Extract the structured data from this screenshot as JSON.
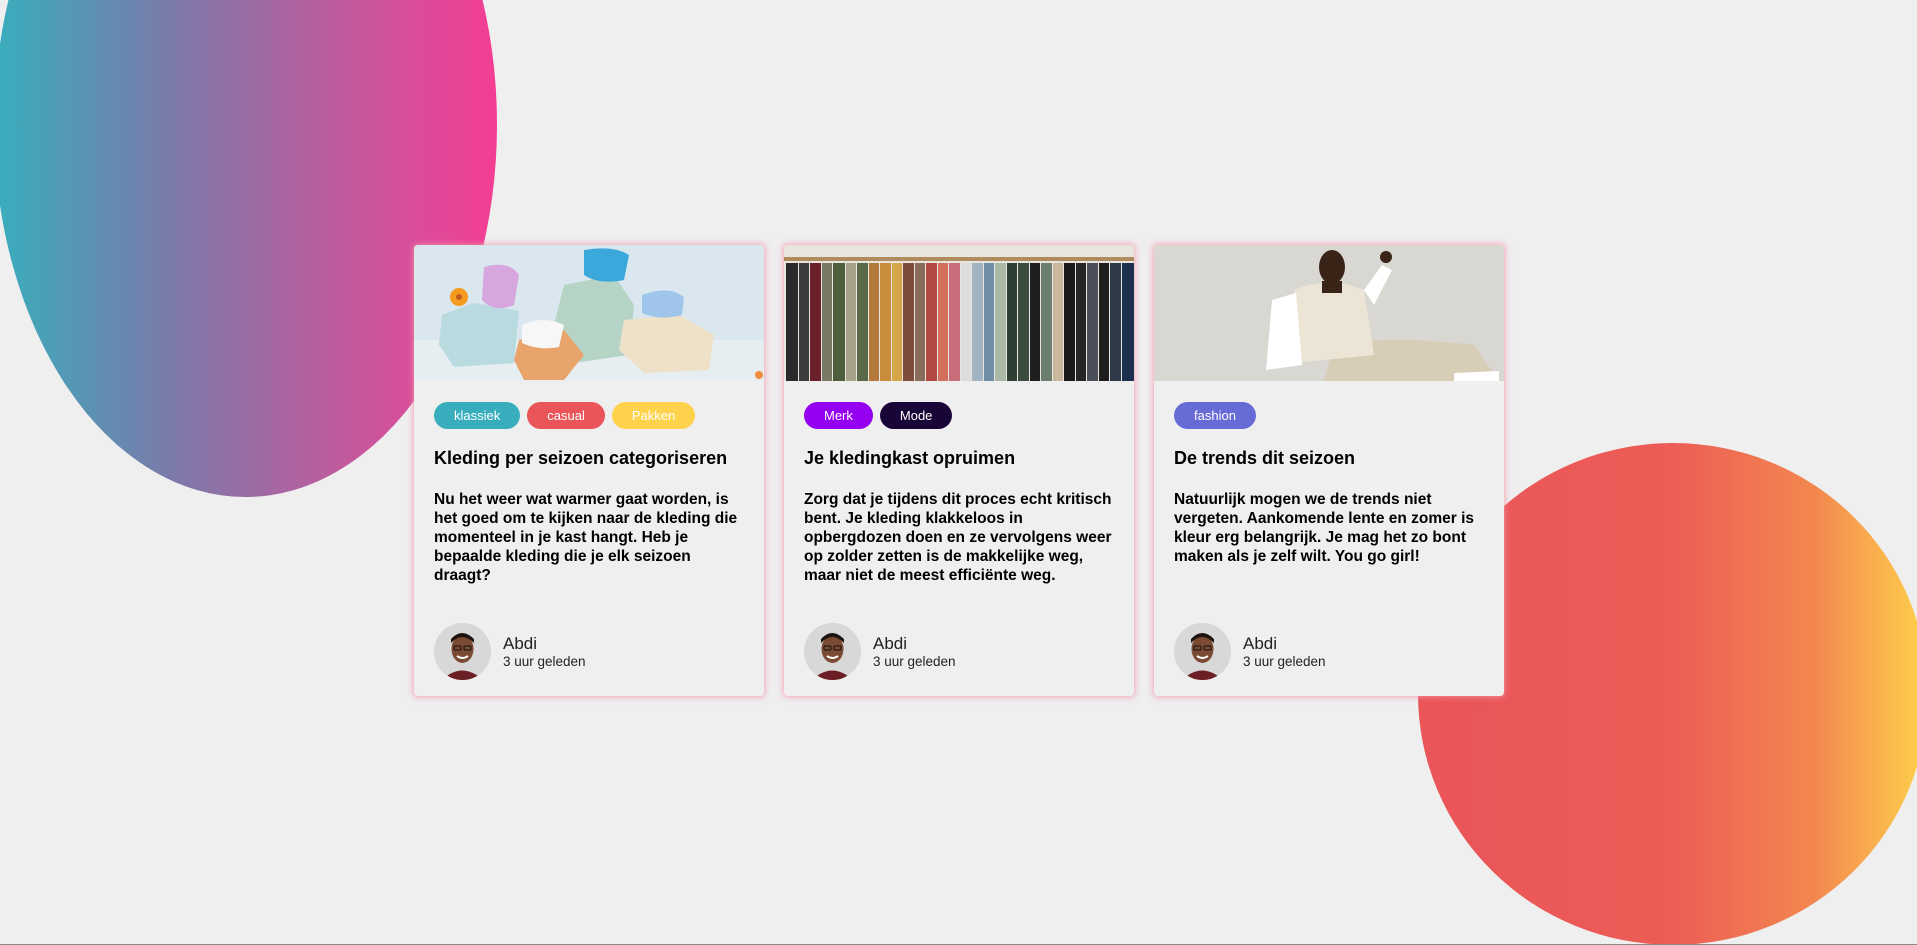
{
  "colors": {
    "background": "#efefef",
    "circle_left_gradient": [
      "#38aebc",
      "#f53d94"
    ],
    "circle_right_gradient": [
      "#ea5559",
      "#ffd24c"
    ]
  },
  "cards": [
    {
      "image": "shoes-sandals-image",
      "tags": [
        {
          "label": "klassiek",
          "color": "#38aebc"
        },
        {
          "label": "casual",
          "color": "#ea5559"
        },
        {
          "label": "Pakken",
          "color": "#ffd24c"
        }
      ],
      "title": "Kleding per seizoen categoriseren",
      "text": "Nu het weer wat warmer gaat worden, is het goed om te kijken naar de kleding die momenteel in je kast hangt. Heb je bepaalde kleding die je elk seizoen draagt?",
      "author": {
        "name": "Abdi",
        "time": "3 uur geleden"
      }
    },
    {
      "image": "clothing-rack-image",
      "tags": [
        {
          "label": "Merk",
          "color": "#9600f0"
        },
        {
          "label": "Mode",
          "color": "#1a0538"
        }
      ],
      "title": "Je kledingkast opruimen",
      "text": "Zorg dat je tijdens dit proces echt kritisch bent. Je kleding klakkeloos in opbergdozen doen en ze vervolgens weer op zolder zetten is de makkelijke weg, maar niet de meest efficiënte weg.",
      "author": {
        "name": "Abdi",
        "time": "3 uur geleden"
      }
    },
    {
      "image": "fashion-model-image",
      "tags": [
        {
          "label": "fashion",
          "color": "#666bd6"
        }
      ],
      "title": "De trends dit seizoen",
      "text": "Natuurlijk mogen we de trends niet vergeten. Aankomende lente en zomer is kleur erg belangrijk. Je mag het zo bont maken als je zelf wilt. You go girl!",
      "author": {
        "name": "Abdi",
        "time": "3 uur geleden"
      }
    }
  ]
}
